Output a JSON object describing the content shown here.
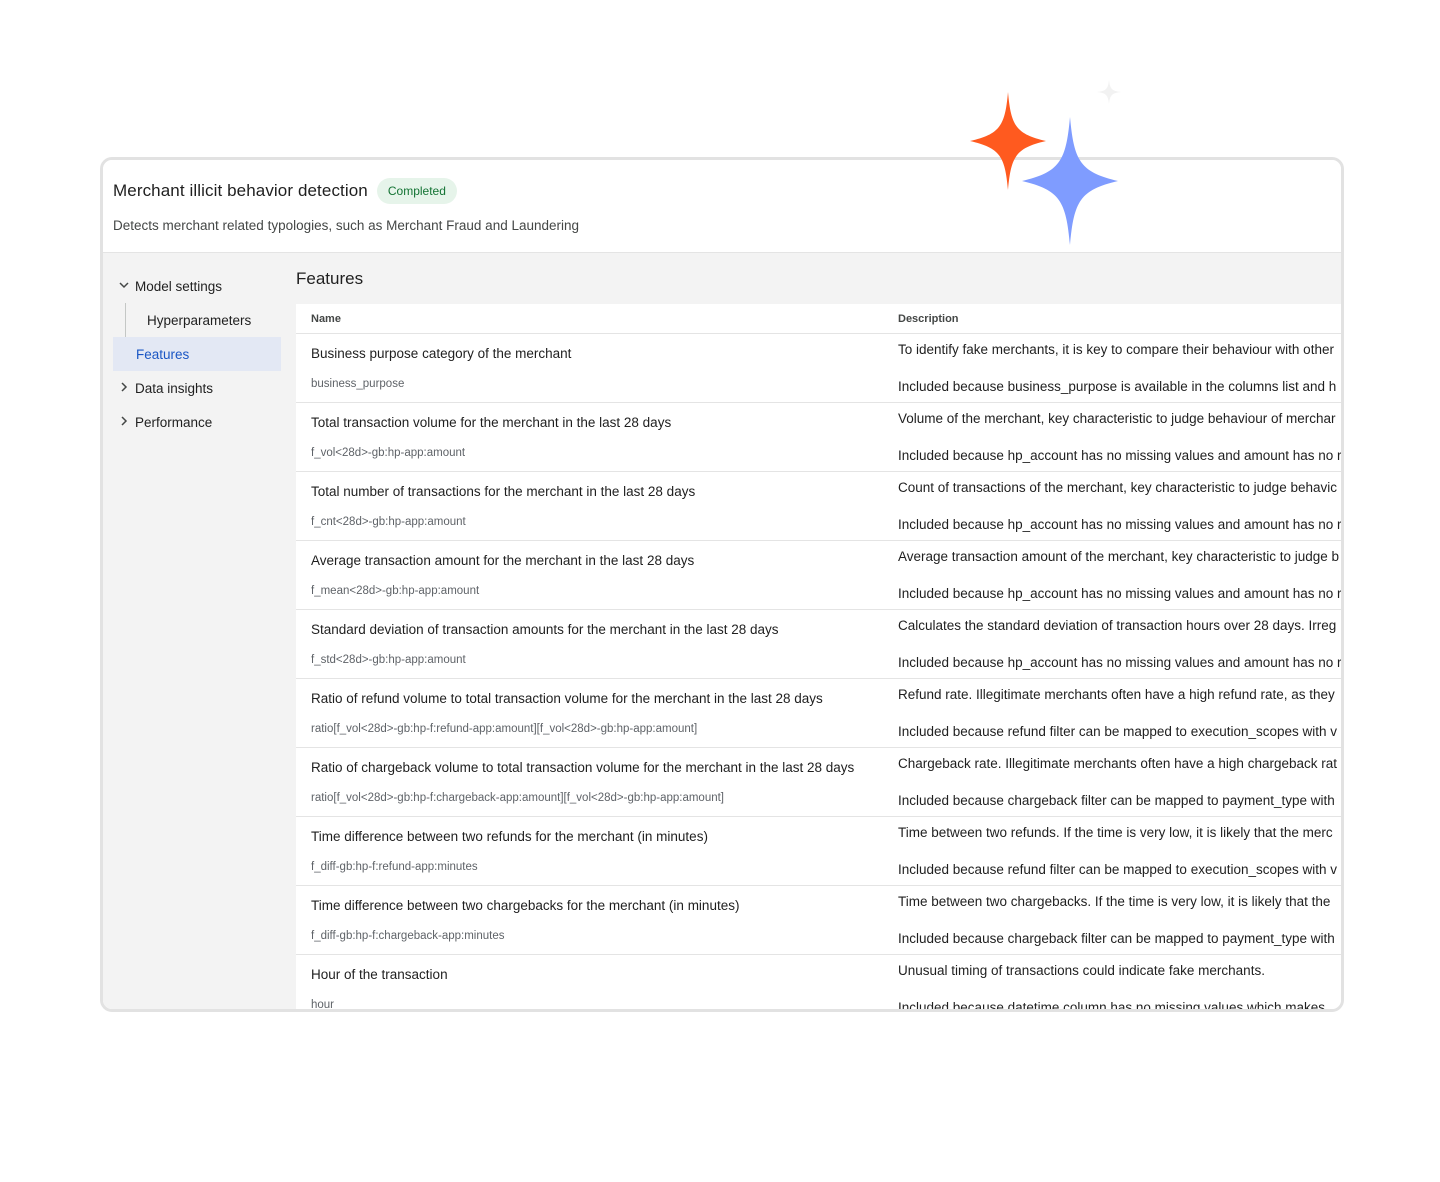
{
  "header": {
    "title": "Merchant illicit behavior detection",
    "status_badge": "Completed",
    "subtitle": "Detects merchant related typologies, such as Merchant Fraud and Laundering"
  },
  "sidenav": {
    "model_settings": "Model settings",
    "hyperparameters": "Hyperparameters",
    "features": "Features",
    "data_insights": "Data insights",
    "performance": "Performance"
  },
  "section_title": "Features",
  "table": {
    "columns": {
      "name": "Name",
      "description": "Description"
    },
    "rows": [
      {
        "name": "Business purpose category of the merchant",
        "id": "business_purpose",
        "description": "To identify fake merchants, it is key to compare their behaviour with other",
        "reason": "Included because business_purpose is available in the columns list and h"
      },
      {
        "name": "Total transaction volume for the merchant in the last 28 days",
        "id": "f_vol<28d>-gb:hp-app:amount",
        "description": "Volume of the merchant, key characteristic to judge behaviour of merchar",
        "reason": "Included because hp_account has no missing values and amount has no r"
      },
      {
        "name": "Total number of transactions for the merchant in the last 28 days",
        "id": "f_cnt<28d>-gb:hp-app:amount",
        "description": "Count of transactions of the merchant, key characteristic to judge behavic",
        "reason": "Included because hp_account has no missing values and amount has no r"
      },
      {
        "name": "Average transaction amount for the merchant in the last 28 days",
        "id": "f_mean<28d>-gb:hp-app:amount",
        "description": "Average transaction amount of the merchant, key characteristic to judge b",
        "reason": "Included because hp_account has no missing values and amount has no r"
      },
      {
        "name": "Standard deviation of transaction amounts for the merchant in the last 28 days",
        "id": "f_std<28d>-gb:hp-app:amount",
        "description": "Calculates the standard deviation of transaction hours over 28 days. Irreg",
        "reason": "Included because hp_account has no missing values and amount has no r"
      },
      {
        "name": "Ratio of refund volume to total transaction volume for the merchant in the last 28 days",
        "id": "ratio[f_vol<28d>-gb:hp-f:refund-app:amount][f_vol<28d>-gb:hp-app:amount]",
        "description": "Refund rate. Illegitimate merchants often have a high refund rate, as they",
        "reason": "Included because refund filter can be mapped to execution_scopes with v"
      },
      {
        "name": "Ratio of chargeback volume to total transaction volume for the merchant in the last 28 days",
        "id": "ratio[f_vol<28d>-gb:hp-f:chargeback-app:amount][f_vol<28d>-gb:hp-app:amount]",
        "description": "Chargeback rate. Illegitimate merchants often have a high chargeback rat",
        "reason": "Included because chargeback filter can be mapped to payment_type with"
      },
      {
        "name": "Time difference between two refunds for the merchant (in minutes)",
        "id": "f_diff-gb:hp-f:refund-app:minutes",
        "description": "Time between two refunds. If the time is very low, it is likely that the merc",
        "reason": "Included because refund filter can be mapped to execution_scopes with v"
      },
      {
        "name": "Time difference between two chargebacks for the merchant (in minutes)",
        "id": "f_diff-gb:hp-f:chargeback-app:minutes",
        "description": "Time between two chargebacks. If the time is very low, it is likely that the",
        "reason": "Included because chargeback filter can be mapped to payment_type with"
      },
      {
        "name": "Hour of the transaction",
        "id": "hour",
        "description": "Unusual timing of transactions could indicate fake merchants.",
        "reason": "Included because datetime column has no missing values which makes"
      }
    ]
  },
  "colors": {
    "sparkle_orange": "#ff5a1f",
    "sparkle_blue": "#7f9cff",
    "active_nav_bg": "#e3e8f4",
    "active_nav_text": "#1a56c4",
    "badge_bg": "#e6f4ea",
    "badge_text": "#137333"
  },
  "icons": {
    "expand": "chevron-down-icon",
    "collapse": "chevron-right-icon",
    "decoration": "sparkle-icon"
  }
}
